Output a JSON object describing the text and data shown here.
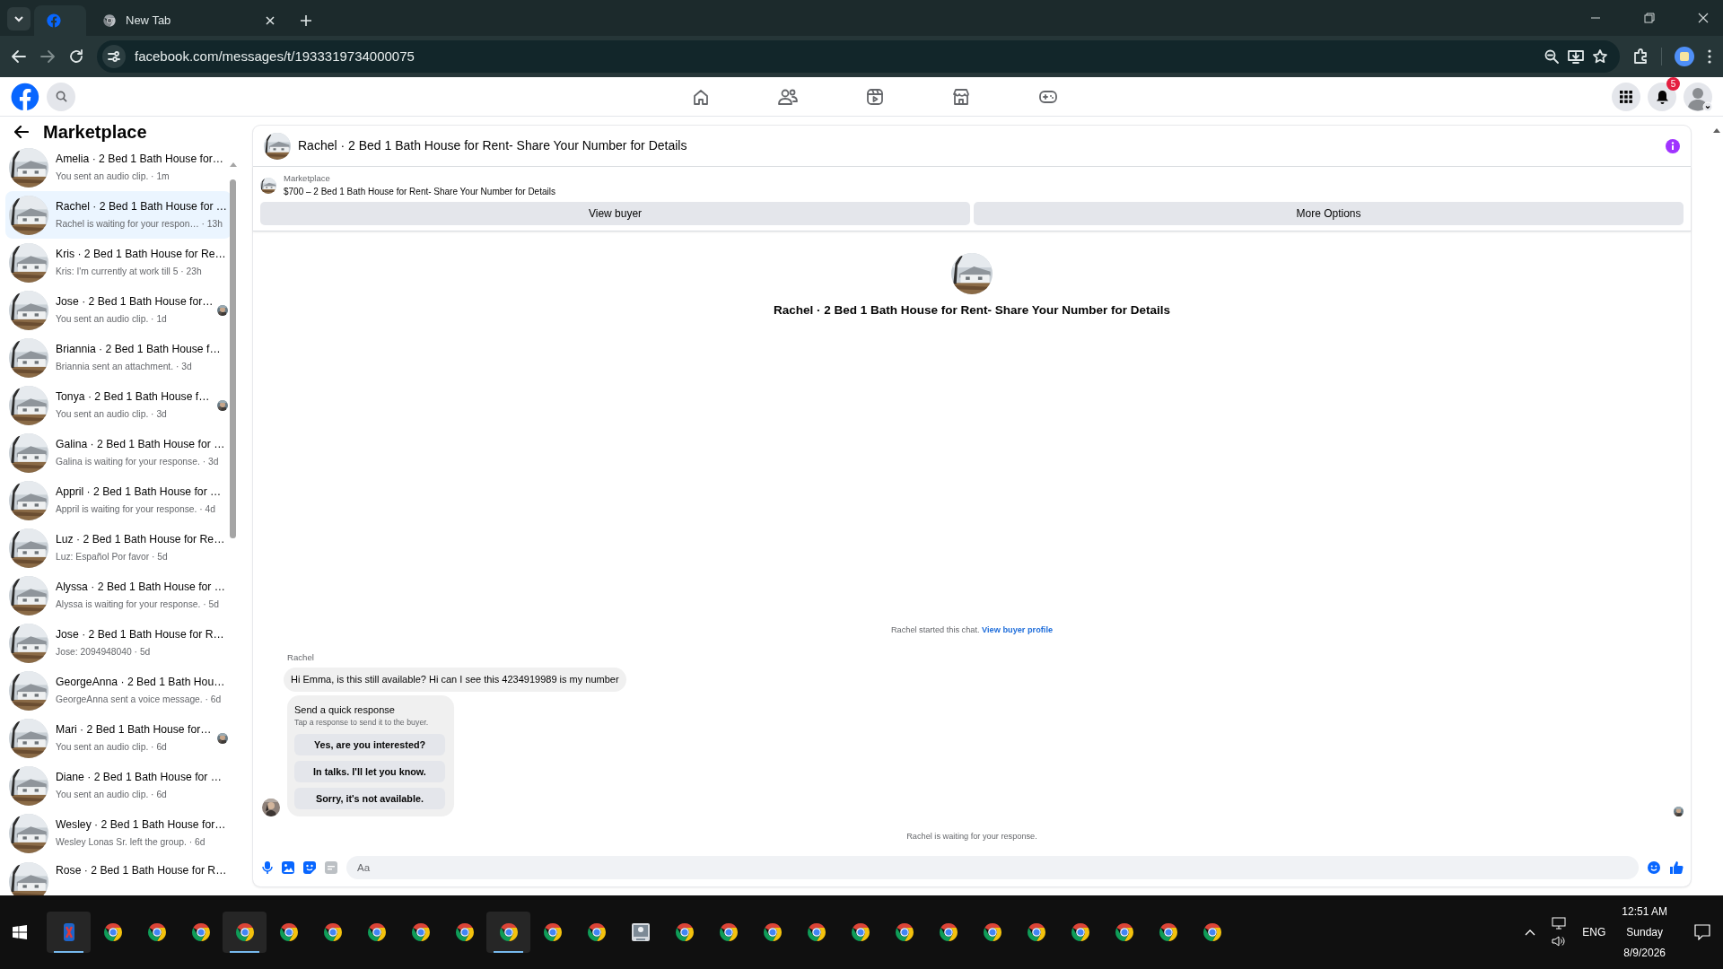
{
  "browser": {
    "tabs": [
      {
        "kind": "facebook",
        "selected": true
      },
      {
        "kind": "chrome",
        "label": "New Tab",
        "selected": false
      }
    ],
    "address": "facebook.com/messages/t/1933319734000075"
  },
  "fb_header": {
    "notification_count": "5"
  },
  "sidebar": {
    "title": "Marketplace",
    "conversations": [
      {
        "title": "Amelia · 2 Bed 1 Bath House for…",
        "preview": "You sent an audio clip. · 1m",
        "selected": false,
        "read_receipt": false
      },
      {
        "title": "Rachel · 2 Bed 1 Bath House for …",
        "preview": "Rachel is waiting for your respon… · 13h",
        "selected": true,
        "read_receipt": false
      },
      {
        "title": "Kris · 2 Bed 1 Bath House for Re…",
        "preview": "Kris: I'm currently at work till 5 · 23h",
        "selected": false,
        "read_receipt": false
      },
      {
        "title": "Jose · 2 Bed 1 Bath House for…",
        "preview": "You sent an audio clip. · 1d",
        "selected": false,
        "read_receipt": true
      },
      {
        "title": "Briannia · 2 Bed 1 Bath House f…",
        "preview": "Briannia sent an attachment. · 3d",
        "selected": false,
        "read_receipt": false
      },
      {
        "title": "Tonya · 2 Bed 1 Bath House f…",
        "preview": "You sent an audio clip. · 3d",
        "selected": false,
        "read_receipt": true
      },
      {
        "title": "Galina · 2 Bed 1 Bath House for …",
        "preview": "Galina is waiting for your response. · 3d",
        "selected": false,
        "read_receipt": false
      },
      {
        "title": "Appril · 2 Bed 1 Bath House for …",
        "preview": "Appril is waiting for your response. · 4d",
        "selected": false,
        "read_receipt": false
      },
      {
        "title": "Luz · 2 Bed 1 Bath House for Re…",
        "preview": "Luz: Español Por favor · 5d",
        "selected": false,
        "read_receipt": false
      },
      {
        "title": "Alyssa · 2 Bed 1 Bath House for …",
        "preview": "Alyssa is waiting for your response. · 5d",
        "selected": false,
        "read_receipt": false
      },
      {
        "title": "Jose · 2 Bed 1 Bath House for R…",
        "preview": "Jose: 2094948040 · 5d",
        "selected": false,
        "read_receipt": false
      },
      {
        "title": "GeorgeAnna · 2 Bed 1 Bath Hou…",
        "preview": "GeorgeAnna sent a voice message. · 6d",
        "selected": false,
        "read_receipt": false
      },
      {
        "title": "Mari · 2 Bed 1 Bath House for…",
        "preview": "You sent an audio clip. · 6d",
        "selected": false,
        "read_receipt": true
      },
      {
        "title": "Diane · 2 Bed 1 Bath House for …",
        "preview": "You sent an audio clip. · 6d",
        "selected": false,
        "read_receipt": false
      },
      {
        "title": "Wesley · 2 Bed 1 Bath House for…",
        "preview": "Wesley Lonas Sr. left the group. · 6d",
        "selected": false,
        "read_receipt": false
      },
      {
        "title": "Rose · 2 Bed 1 Bath House for R…",
        "selected": false,
        "read_receipt": false
      }
    ]
  },
  "chat": {
    "title": "Rachel · 2 Bed 1 Bath House for Rent- Share Your Number for Details",
    "listing": {
      "label": "Marketplace",
      "text": "$700 – 2 Bed 1 Bath House for Rent- Share Your Number for Details"
    },
    "actions": [
      "View buyer",
      "More Options"
    ],
    "intro_title": "Rachel · 2 Bed 1 Bath House for Rent- Share Your Number for Details",
    "started": {
      "text": "Rachel started this chat.",
      "link": "View buyer profile"
    },
    "messages": [
      {
        "sender": "Rachel",
        "text": "Hi Emma, is this still available? Hi can I see this 4234919989 is my number"
      }
    ],
    "quick_response": {
      "title": "Send a quick response",
      "subtitle": "Tap a response to send it to the buyer.",
      "options": [
        "Yes, are you interested?",
        "In talks. I'll let you know.",
        "Sorry, it's not available."
      ]
    },
    "status": "Rachel is waiting for your response.",
    "composer": {
      "placeholder": "Aa"
    }
  },
  "taskbar": {
    "apps": [
      {
        "kind": "app",
        "active": true
      },
      {
        "kind": "chrome",
        "active": false
      },
      {
        "kind": "chrome",
        "active": false
      },
      {
        "kind": "chrome",
        "active": false
      },
      {
        "kind": "chrome",
        "active": true
      },
      {
        "kind": "chrome",
        "active": false
      },
      {
        "kind": "chrome",
        "active": false
      },
      {
        "kind": "chrome",
        "active": false
      },
      {
        "kind": "chrome",
        "active": false
      },
      {
        "kind": "chrome",
        "active": false
      },
      {
        "kind": "chrome",
        "active": true
      },
      {
        "kind": "chrome",
        "active": false
      },
      {
        "kind": "chrome",
        "active": false
      },
      {
        "kind": "viewer",
        "active": false
      },
      {
        "kind": "chrome",
        "active": false
      },
      {
        "kind": "chrome",
        "active": false
      },
      {
        "kind": "chrome",
        "active": false
      },
      {
        "kind": "chrome",
        "active": false
      },
      {
        "kind": "chrome",
        "active": false
      },
      {
        "kind": "chrome",
        "active": false
      },
      {
        "kind": "chrome",
        "active": false
      },
      {
        "kind": "chrome",
        "active": false
      },
      {
        "kind": "chrome",
        "active": false
      },
      {
        "kind": "chrome",
        "active": false
      },
      {
        "kind": "chrome",
        "active": false
      },
      {
        "kind": "chrome",
        "active": false
      },
      {
        "kind": "chrome",
        "active": false
      }
    ],
    "tray": {
      "language": "ENG",
      "time": "12:51 AM",
      "day": "Sunday",
      "date": "8/9/2026"
    }
  }
}
